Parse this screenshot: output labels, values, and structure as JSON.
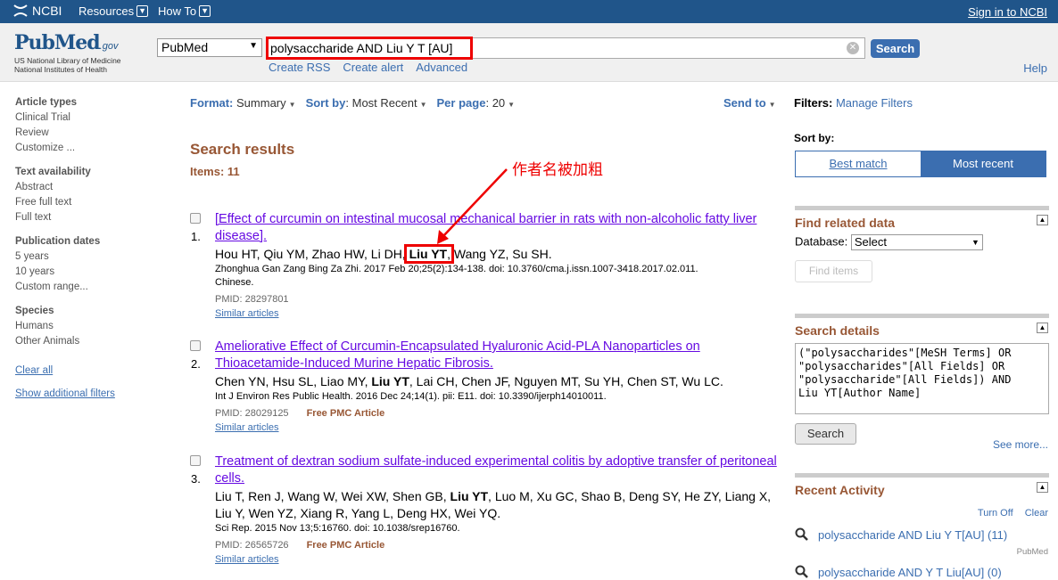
{
  "topbar": {
    "brand": "NCBI",
    "resources": "Resources",
    "howto": "How To",
    "signin": "Sign in to NCBI"
  },
  "logo": {
    "main": "PubMed",
    "gov": ".gov",
    "line1": "US National Library of Medicine",
    "line2": "National Institutes of Health"
  },
  "search": {
    "database": "PubMed",
    "query": "polysaccharide AND Liu Y T [AU]",
    "button": "Search",
    "create_rss": "Create RSS",
    "create_alert": "Create alert",
    "advanced": "Advanced",
    "help": "Help"
  },
  "left_filters": {
    "groups": [
      {
        "title": "Article types",
        "items": [
          "Clinical Trial",
          "Review",
          "Customize ..."
        ]
      },
      {
        "title": "Text availability",
        "items": [
          "Abstract",
          "Free full text",
          "Full text"
        ]
      },
      {
        "title": "Publication dates",
        "items": [
          "5 years",
          "10 years",
          "Custom range..."
        ]
      },
      {
        "title": "Species",
        "items": [
          "Humans",
          "Other Animals"
        ]
      }
    ],
    "clear_all": "Clear all",
    "show_additional": "Show additional filters"
  },
  "toolbar": {
    "format_label": "Format:",
    "format_value": "Summary",
    "sort_label": "Sort by",
    "sort_sep": ":",
    "sort_value": "Most Recent",
    "perpage_label": "Per page",
    "perpage_sep": ":",
    "perpage_value": "20",
    "send_to": "Send to"
  },
  "results": {
    "title": "Search results",
    "count": "Items: 11",
    "items": [
      {
        "num": "1.",
        "title": "[Effect of curcumin on intestinal mucosal mechanical barrier in rats with non-alcoholic fatty liver disease].",
        "authors_before": "Hou HT, Qiu YM, Zhao HW, Li DH, ",
        "authors_bold": "Liu YT",
        "authors_after": ", Wang YZ, Su SH.",
        "source": "Zhonghua Gan Zang Bing Za Zhi. 2017 Feb 20;25(2):134-138. doi: 10.3760/cma.j.issn.1007-3418.2017.02.011.",
        "language": "Chinese.",
        "pmid": "PMID: 28297801",
        "pmc": "",
        "similar": "Similar articles"
      },
      {
        "num": "2.",
        "title": "Ameliorative Effect of Curcumin-Encapsulated Hyaluronic Acid-PLA Nanoparticles on Thioacetamide-Induced Murine Hepatic Fibrosis.",
        "authors_before": "Chen YN, Hsu SL, Liao MY, ",
        "authors_bold": "Liu YT",
        "authors_after": ", Lai CH, Chen JF, Nguyen MT, Su YH, Chen ST, Wu LC.",
        "source": "Int J Environ Res Public Health. 2016 Dec 24;14(1). pii: E11. doi: 10.3390/ijerph14010011.",
        "language": "",
        "pmid": "PMID: 28029125",
        "pmc": "Free PMC Article",
        "similar": "Similar articles"
      },
      {
        "num": "3.",
        "title": "Treatment of dextran sodium sulfate-induced experimental colitis by adoptive transfer of peritoneal cells.",
        "authors_before": "Liu T, Ren J, Wang W, Wei XW, Shen GB, ",
        "authors_bold": "Liu YT",
        "authors_after": ", Luo M, Xu GC, Shao B, Deng SY, He ZY, Liang X, Liu Y, Wen YZ, Xiang R, Yang L, Deng HX, Wei YQ.",
        "source": "Sci Rep. 2015 Nov 13;5:16760. doi: 10.1038/srep16760.",
        "language": "",
        "pmid": "PMID: 26565726",
        "pmc": "Free PMC Article",
        "similar": "Similar articles"
      }
    ]
  },
  "annotation": {
    "text": "作者名被加粗",
    "color": "#ee0000"
  },
  "right": {
    "filters_label": "Filters:",
    "manage_filters": "Manage Filters",
    "sort_by": "Sort by:",
    "best_match": "Best match",
    "most_recent": "Most recent",
    "find_related": "Find related data",
    "database_label": "Database:",
    "database_value": "Select",
    "find_items": "Find items",
    "search_details_title": "Search details",
    "search_details": "(\"polysaccharides\"[MeSH Terms] OR\n\"polysaccharides\"[All Fields] OR\n\"polysaccharide\"[All Fields]) AND\nLiu YT[Author Name]",
    "details_search_btn": "Search",
    "see_more": "See more...",
    "recent_activity": "Recent Activity",
    "turn_off": "Turn Off",
    "clear": "Clear",
    "recent_items": [
      {
        "text": "polysaccharide AND Liu Y T[AU] (11)",
        "src": "PubMed"
      },
      {
        "text": "polysaccharide AND Y T Liu[AU] (0)",
        "src": ""
      }
    ]
  },
  "colors": {
    "ncbi_blue": "#20558a",
    "link_blue": "#3b6eb0",
    "title_purple": "#660ae2",
    "heading_brown": "#985735",
    "highlight_red": "#ee0000"
  }
}
